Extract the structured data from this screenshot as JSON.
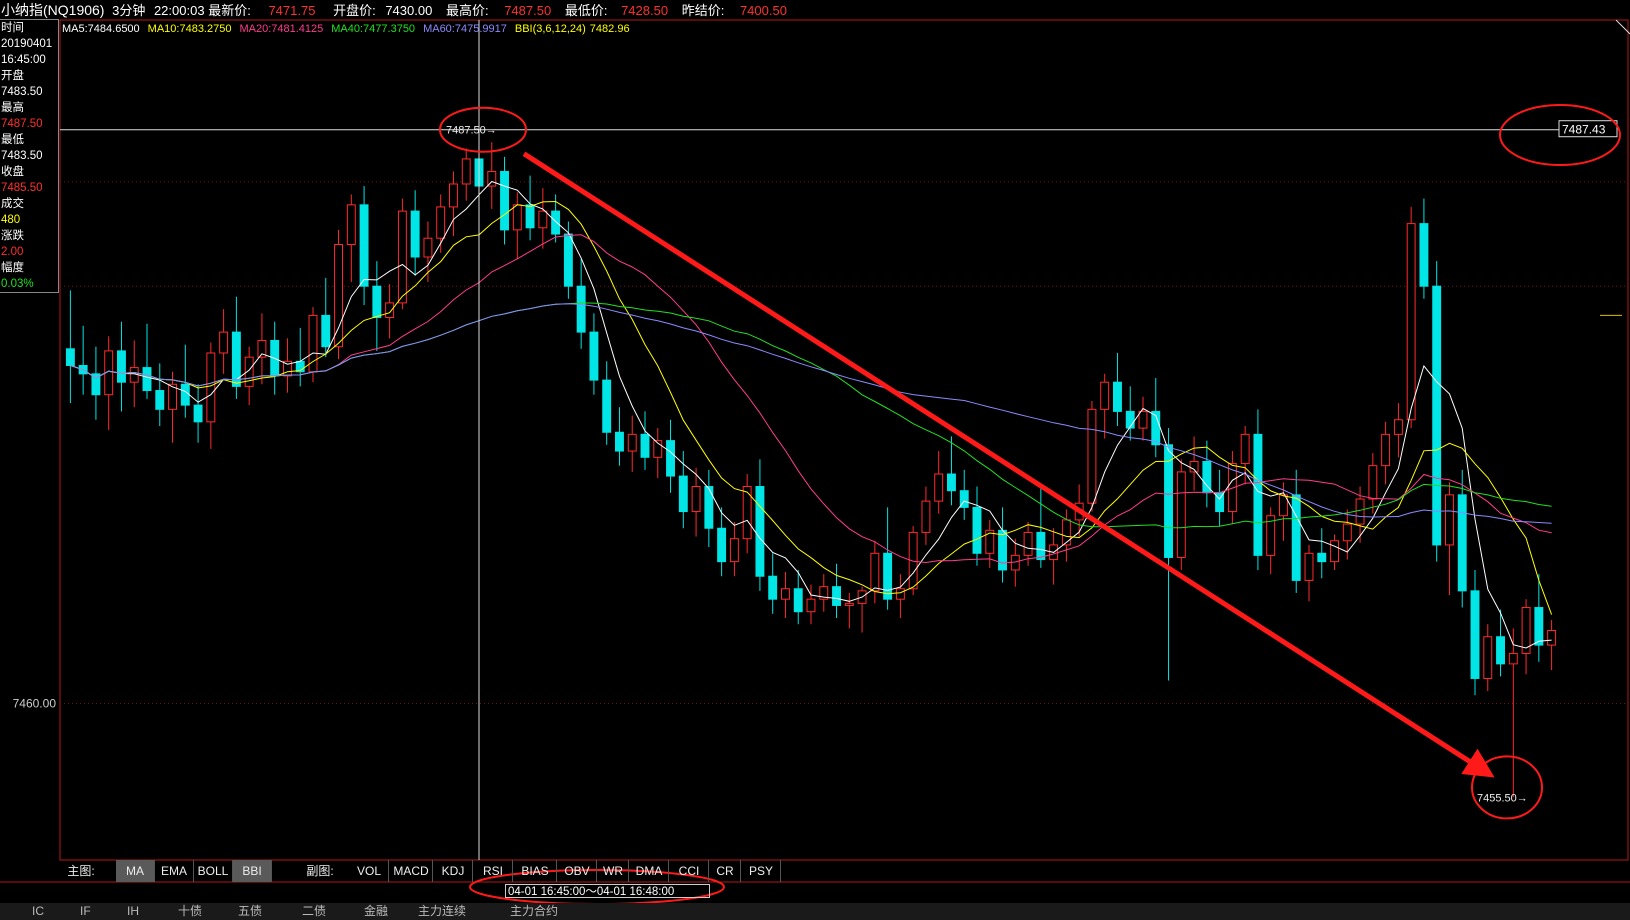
{
  "header": {
    "instrument": "小纳指(NQ1906)",
    "period": "3分钟",
    "time": "22:00:03",
    "last_label": "最新价:",
    "last_value": "7471.75",
    "open_label": "开盘价:",
    "open_value": "7430.00",
    "high_label": "最高价:",
    "high_value": "7487.50",
    "low_label": "最低价:",
    "low_value": "7428.50",
    "prev_close_label": "昨结价:",
    "prev_close_value": "7400.50"
  },
  "ma_legend": [
    {
      "text": "MA5:7484.6500",
      "color": "#ffffff"
    },
    {
      "text": "MA10:7483.2750",
      "color": "#ffff00"
    },
    {
      "text": "MA20:7481.4125",
      "color": "#ff3c8c"
    },
    {
      "text": "MA40:7477.3750",
      "color": "#20e020"
    },
    {
      "text": "MA60:7475.9917",
      "color": "#8a8aff"
    },
    {
      "text": "BBI(3,6,12,24)",
      "color": "#ffff00"
    },
    {
      "text": "7482.96",
      "color": "#ffff00"
    }
  ],
  "info_panel": [
    {
      "text": "时间",
      "color": "#ffffff"
    },
    {
      "text": "20190401",
      "color": "#ffffff"
    },
    {
      "text": "16:45:00",
      "color": "#ffffff"
    },
    {
      "text": "开盘",
      "color": "#ffffff"
    },
    {
      "text": "7483.50",
      "color": "#ffffff"
    },
    {
      "text": "最高",
      "color": "#ffffff"
    },
    {
      "text": "7487.50",
      "color": "#ff3030"
    },
    {
      "text": "最低",
      "color": "#ffffff"
    },
    {
      "text": "7483.50",
      "color": "#ffffff"
    },
    {
      "text": "收盘",
      "color": "#ffffff"
    },
    {
      "text": "7485.50",
      "color": "#ff3030"
    },
    {
      "text": "成交",
      "color": "#ffffff"
    },
    {
      "text": "480",
      "color": "#ffff00"
    },
    {
      "text": "涨跌",
      "color": "#ffffff"
    },
    {
      "text": "2.00",
      "color": "#ff3030"
    },
    {
      "text": "幅度",
      "color": "#ffffff"
    },
    {
      "text": "0.03%",
      "color": "#20e020"
    }
  ],
  "chart_labels": {
    "y_tick": "7460.00",
    "crosshair_price": "7487.50",
    "right_price": "7487.43",
    "low_price": "7455.50"
  },
  "tabs": {
    "main_label": "主图:",
    "main": [
      "MA",
      "EMA",
      "BOLL",
      "BBI"
    ],
    "main_selected": [
      "MA",
      "BBI"
    ],
    "sub_label": "副图:",
    "sub": [
      "VOL",
      "MACD",
      "KDJ",
      "RSI",
      "BIAS",
      "OBV",
      "WR",
      "DMA",
      "CCI",
      "CR",
      "PSY"
    ]
  },
  "time_range": "04-01  16:45:00～04-01 16:48:00",
  "bottom_nav": [
    "IC",
    "IF",
    "IH",
    "十债",
    "五债",
    "二债",
    "金融",
    "主力连续",
    "主力合约"
  ],
  "colors": {
    "up": "#ff2a2a",
    "down": "#00e5e5",
    "annotation": "#ff1a1a"
  },
  "chart_data": {
    "type": "candlestick",
    "y_ticks": [
      7460.0
    ],
    "ylim": [
      7452.5,
      7491.8
    ],
    "candle_count": 120,
    "annotations": {
      "high": 7487.5,
      "low": 7455.5,
      "right_price": 7487.43,
      "trend_arrow": "from 7487.50 high down to 7455.50 low"
    },
    "ohlc": [
      [
        7477.0,
        7479.8,
        7474.4,
        7476.2
      ],
      [
        7476.2,
        7478.1,
        7474.8,
        7475.8
      ],
      [
        7475.8,
        7477.1,
        7473.6,
        7474.8
      ],
      [
        7474.8,
        7477.6,
        7473.1,
        7476.9
      ],
      [
        7476.9,
        7478.3,
        7474.0,
        7475.4
      ],
      [
        7475.4,
        7477.4,
        7474.2,
        7476.1
      ],
      [
        7476.1,
        7478.2,
        7474.6,
        7475.0
      ],
      [
        7475.0,
        7476.3,
        7473.3,
        7474.1
      ],
      [
        7474.1,
        7475.9,
        7472.5,
        7475.3
      ],
      [
        7475.3,
        7477.2,
        7473.7,
        7474.3
      ],
      [
        7474.3,
        7475.3,
        7472.5,
        7473.5
      ],
      [
        7473.5,
        7477.3,
        7472.2,
        7476.8
      ],
      [
        7476.8,
        7478.9,
        7475.8,
        7477.8
      ],
      [
        7477.8,
        7479.5,
        7474.6,
        7475.2
      ],
      [
        7475.2,
        7477.1,
        7474.3,
        7476.6
      ],
      [
        7476.6,
        7478.7,
        7475.3,
        7477.4
      ],
      [
        7477.4,
        7478.3,
        7474.8,
        7475.7
      ],
      [
        7475.7,
        7477.5,
        7474.9,
        7476.4
      ],
      [
        7476.4,
        7478.0,
        7475.2,
        7475.9
      ],
      [
        7475.9,
        7479.0,
        7475.4,
        7478.6
      ],
      [
        7478.6,
        7480.4,
        7476.6,
        7477.1
      ],
      [
        7477.1,
        7482.7,
        7476.5,
        7482.0
      ],
      [
        7482.0,
        7484.4,
        7480.2,
        7483.9
      ],
      [
        7483.9,
        7484.8,
        7479.1,
        7480.0
      ],
      [
        7480.0,
        7481.2,
        7476.9,
        7478.5
      ],
      [
        7478.5,
        7480.1,
        7477.5,
        7479.2
      ],
      [
        7479.2,
        7484.2,
        7478.9,
        7483.6
      ],
      [
        7483.6,
        7484.6,
        7480.5,
        7481.4
      ],
      [
        7481.4,
        7483.1,
        7480.2,
        7482.3
      ],
      [
        7482.3,
        7484.4,
        7481.6,
        7483.8
      ],
      [
        7483.8,
        7485.5,
        7482.4,
        7484.9
      ],
      [
        7484.9,
        7486.6,
        7484.1,
        7486.1
      ],
      [
        7486.1,
        7487.5,
        7484.2,
        7484.8
      ],
      [
        7484.8,
        7486.9,
        7483.7,
        7485.5
      ],
      [
        7485.5,
        7486.2,
        7482.0,
        7482.7
      ],
      [
        7482.7,
        7484.5,
        7481.3,
        7483.9
      ],
      [
        7483.9,
        7485.3,
        7482.2,
        7482.8
      ],
      [
        7482.8,
        7484.7,
        7481.8,
        7483.6
      ],
      [
        7483.6,
        7484.4,
        7482.1,
        7482.5
      ],
      [
        7482.5,
        7483.1,
        7479.4,
        7480.0
      ],
      [
        7480.0,
        7481.3,
        7477.0,
        7477.8
      ],
      [
        7477.8,
        7478.7,
        7474.8,
        7475.5
      ],
      [
        7475.5,
        7476.4,
        7472.4,
        7473.0
      ],
      [
        7473.0,
        7474.2,
        7471.4,
        7472.1
      ],
      [
        7472.1,
        7473.8,
        7471.1,
        7472.9
      ],
      [
        7472.9,
        7474.0,
        7471.2,
        7471.8
      ],
      [
        7471.8,
        7473.2,
        7470.8,
        7472.6
      ],
      [
        7472.6,
        7473.6,
        7470.1,
        7470.9
      ],
      [
        7470.9,
        7472.1,
        7468.4,
        7469.2
      ],
      [
        7469.2,
        7471.3,
        7468.0,
        7470.4
      ],
      [
        7470.4,
        7471.2,
        7467.5,
        7468.4
      ],
      [
        7468.4,
        7469.4,
        7466.1,
        7466.8
      ],
      [
        7466.8,
        7468.7,
        7466.1,
        7467.9
      ],
      [
        7467.9,
        7471.0,
        7467.2,
        7470.4
      ],
      [
        7470.4,
        7471.7,
        7465.4,
        7466.1
      ],
      [
        7466.1,
        7467.2,
        7464.3,
        7465.0
      ],
      [
        7465.0,
        7466.3,
        7464.1,
        7465.5
      ],
      [
        7465.5,
        7466.4,
        7463.8,
        7464.4
      ],
      [
        7464.4,
        7465.7,
        7463.8,
        7465.0
      ],
      [
        7465.0,
        7466.2,
        7464.4,
        7465.6
      ],
      [
        7465.6,
        7466.7,
        7464.1,
        7464.7
      ],
      [
        7464.7,
        7465.3,
        7463.6,
        7464.8
      ],
      [
        7464.8,
        7465.6,
        7463.4,
        7465.4
      ],
      [
        7465.4,
        7467.8,
        7464.8,
        7467.2
      ],
      [
        7467.2,
        7469.4,
        7464.5,
        7465.0
      ],
      [
        7465.0,
        7466.2,
        7464.1,
        7465.5
      ],
      [
        7465.5,
        7468.5,
        7465.2,
        7468.2
      ],
      [
        7468.2,
        7470.4,
        7467.6,
        7469.7
      ],
      [
        7469.7,
        7472.1,
        7469.1,
        7471.0
      ],
      [
        7471.0,
        7472.8,
        7469.5,
        7470.2
      ],
      [
        7470.2,
        7471.2,
        7468.8,
        7469.4
      ],
      [
        7469.4,
        7470.4,
        7466.6,
        7467.2
      ],
      [
        7467.2,
        7468.8,
        7466.5,
        7468.3
      ],
      [
        7468.3,
        7469.4,
        7465.8,
        7466.4
      ],
      [
        7466.4,
        7467.9,
        7465.6,
        7467.1
      ],
      [
        7467.1,
        7468.7,
        7466.6,
        7468.2
      ],
      [
        7468.2,
        7470.4,
        7466.5,
        7466.9
      ],
      [
        7466.9,
        7468.4,
        7465.7,
        7467.6
      ],
      [
        7467.6,
        7469.3,
        7466.8,
        7468.8
      ],
      [
        7468.8,
        7470.5,
        7468.0,
        7469.6
      ],
      [
        7469.6,
        7474.5,
        7469.2,
        7474.1
      ],
      [
        7474.1,
        7475.8,
        7472.7,
        7475.4
      ],
      [
        7475.4,
        7476.8,
        7473.3,
        7474.0
      ],
      [
        7474.0,
        7475.2,
        7472.6,
        7473.2
      ],
      [
        7473.2,
        7474.7,
        7472.6,
        7474.0
      ],
      [
        7474.0,
        7475.6,
        7471.8,
        7472.4
      ],
      [
        7472.4,
        7473.2,
        7461.1,
        7467.0
      ],
      [
        7467.0,
        7471.7,
        7466.4,
        7471.1
      ],
      [
        7471.1,
        7472.8,
        7470.2,
        7471.6
      ],
      [
        7471.6,
        7472.6,
        7469.4,
        7470.1
      ],
      [
        7470.1,
        7471.2,
        7468.5,
        7469.2
      ],
      [
        7469.2,
        7472.1,
        7468.6,
        7471.5
      ],
      [
        7471.5,
        7473.3,
        7470.5,
        7472.9
      ],
      [
        7472.9,
        7474.1,
        7466.4,
        7467.1
      ],
      [
        7467.1,
        7469.4,
        7466.2,
        7469.0
      ],
      [
        7469.0,
        7470.6,
        7467.8,
        7470.0
      ],
      [
        7470.0,
        7471.2,
        7465.3,
        7465.9
      ],
      [
        7465.9,
        7467.6,
        7464.9,
        7467.2
      ],
      [
        7467.2,
        7468.4,
        7466.0,
        7466.8
      ],
      [
        7466.8,
        7468.1,
        7466.4,
        7467.8
      ],
      [
        7467.8,
        7469.3,
        7466.9,
        7468.6
      ],
      [
        7468.6,
        7470.4,
        7467.7,
        7469.8
      ],
      [
        7469.8,
        7472.0,
        7469.1,
        7471.4
      ],
      [
        7471.4,
        7473.5,
        7470.5,
        7472.9
      ],
      [
        7472.9,
        7474.4,
        7471.8,
        7473.6
      ],
      [
        7473.6,
        7483.8,
        7473.2,
        7483.0
      ],
      [
        7483.0,
        7484.2,
        7479.4,
        7480.0
      ],
      [
        7480.0,
        7481.2,
        7466.8,
        7467.6
      ],
      [
        7467.6,
        7470.6,
        7465.2,
        7470.0
      ],
      [
        7470.0,
        7471.2,
        7464.6,
        7465.4
      ],
      [
        7465.4,
        7466.4,
        7460.4,
        7461.2
      ],
      [
        7461.2,
        7463.8,
        7460.6,
        7463.2
      ],
      [
        7463.2,
        7464.5,
        7461.3,
        7461.9
      ],
      [
        7461.9,
        7463.6,
        7455.5,
        7462.4
      ],
      [
        7462.4,
        7465.0,
        7461.4,
        7464.6
      ],
      [
        7464.6,
        7466.2,
        7462.0,
        7462.8
      ],
      [
        7462.8,
        7464.0,
        7461.6,
        7463.5
      ]
    ]
  }
}
